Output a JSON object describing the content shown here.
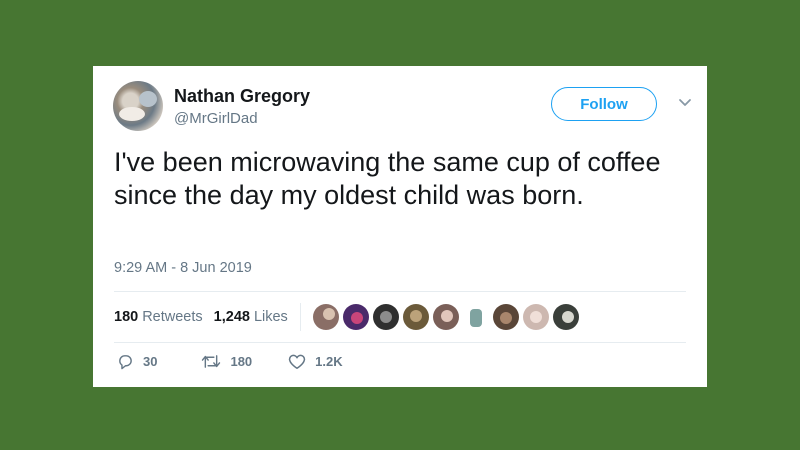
{
  "author": {
    "name": "Nathan Gregory",
    "handle": "@MrGirlDad"
  },
  "follow_button": {
    "label": "Follow"
  },
  "tweet": {
    "text": "I've been microwaving the same cup of coffee since the day my oldest child was born.",
    "timestamp": "9:29 AM - 8 Jun 2019"
  },
  "stats": {
    "retweets_count": "180",
    "retweets_label": "Retweets",
    "likes_count": "1,248",
    "likes_label": "Likes"
  },
  "actions": {
    "replies": "30",
    "retweets": "180",
    "likes": "1.2K"
  },
  "colors": {
    "background": "#477632",
    "accent": "#1da1f2",
    "text": "#14171a",
    "muted": "#657786"
  },
  "icons": {
    "reply": "reply-icon",
    "retweet": "retweet-icon",
    "like": "heart-icon",
    "menu": "chevron-down-icon"
  }
}
